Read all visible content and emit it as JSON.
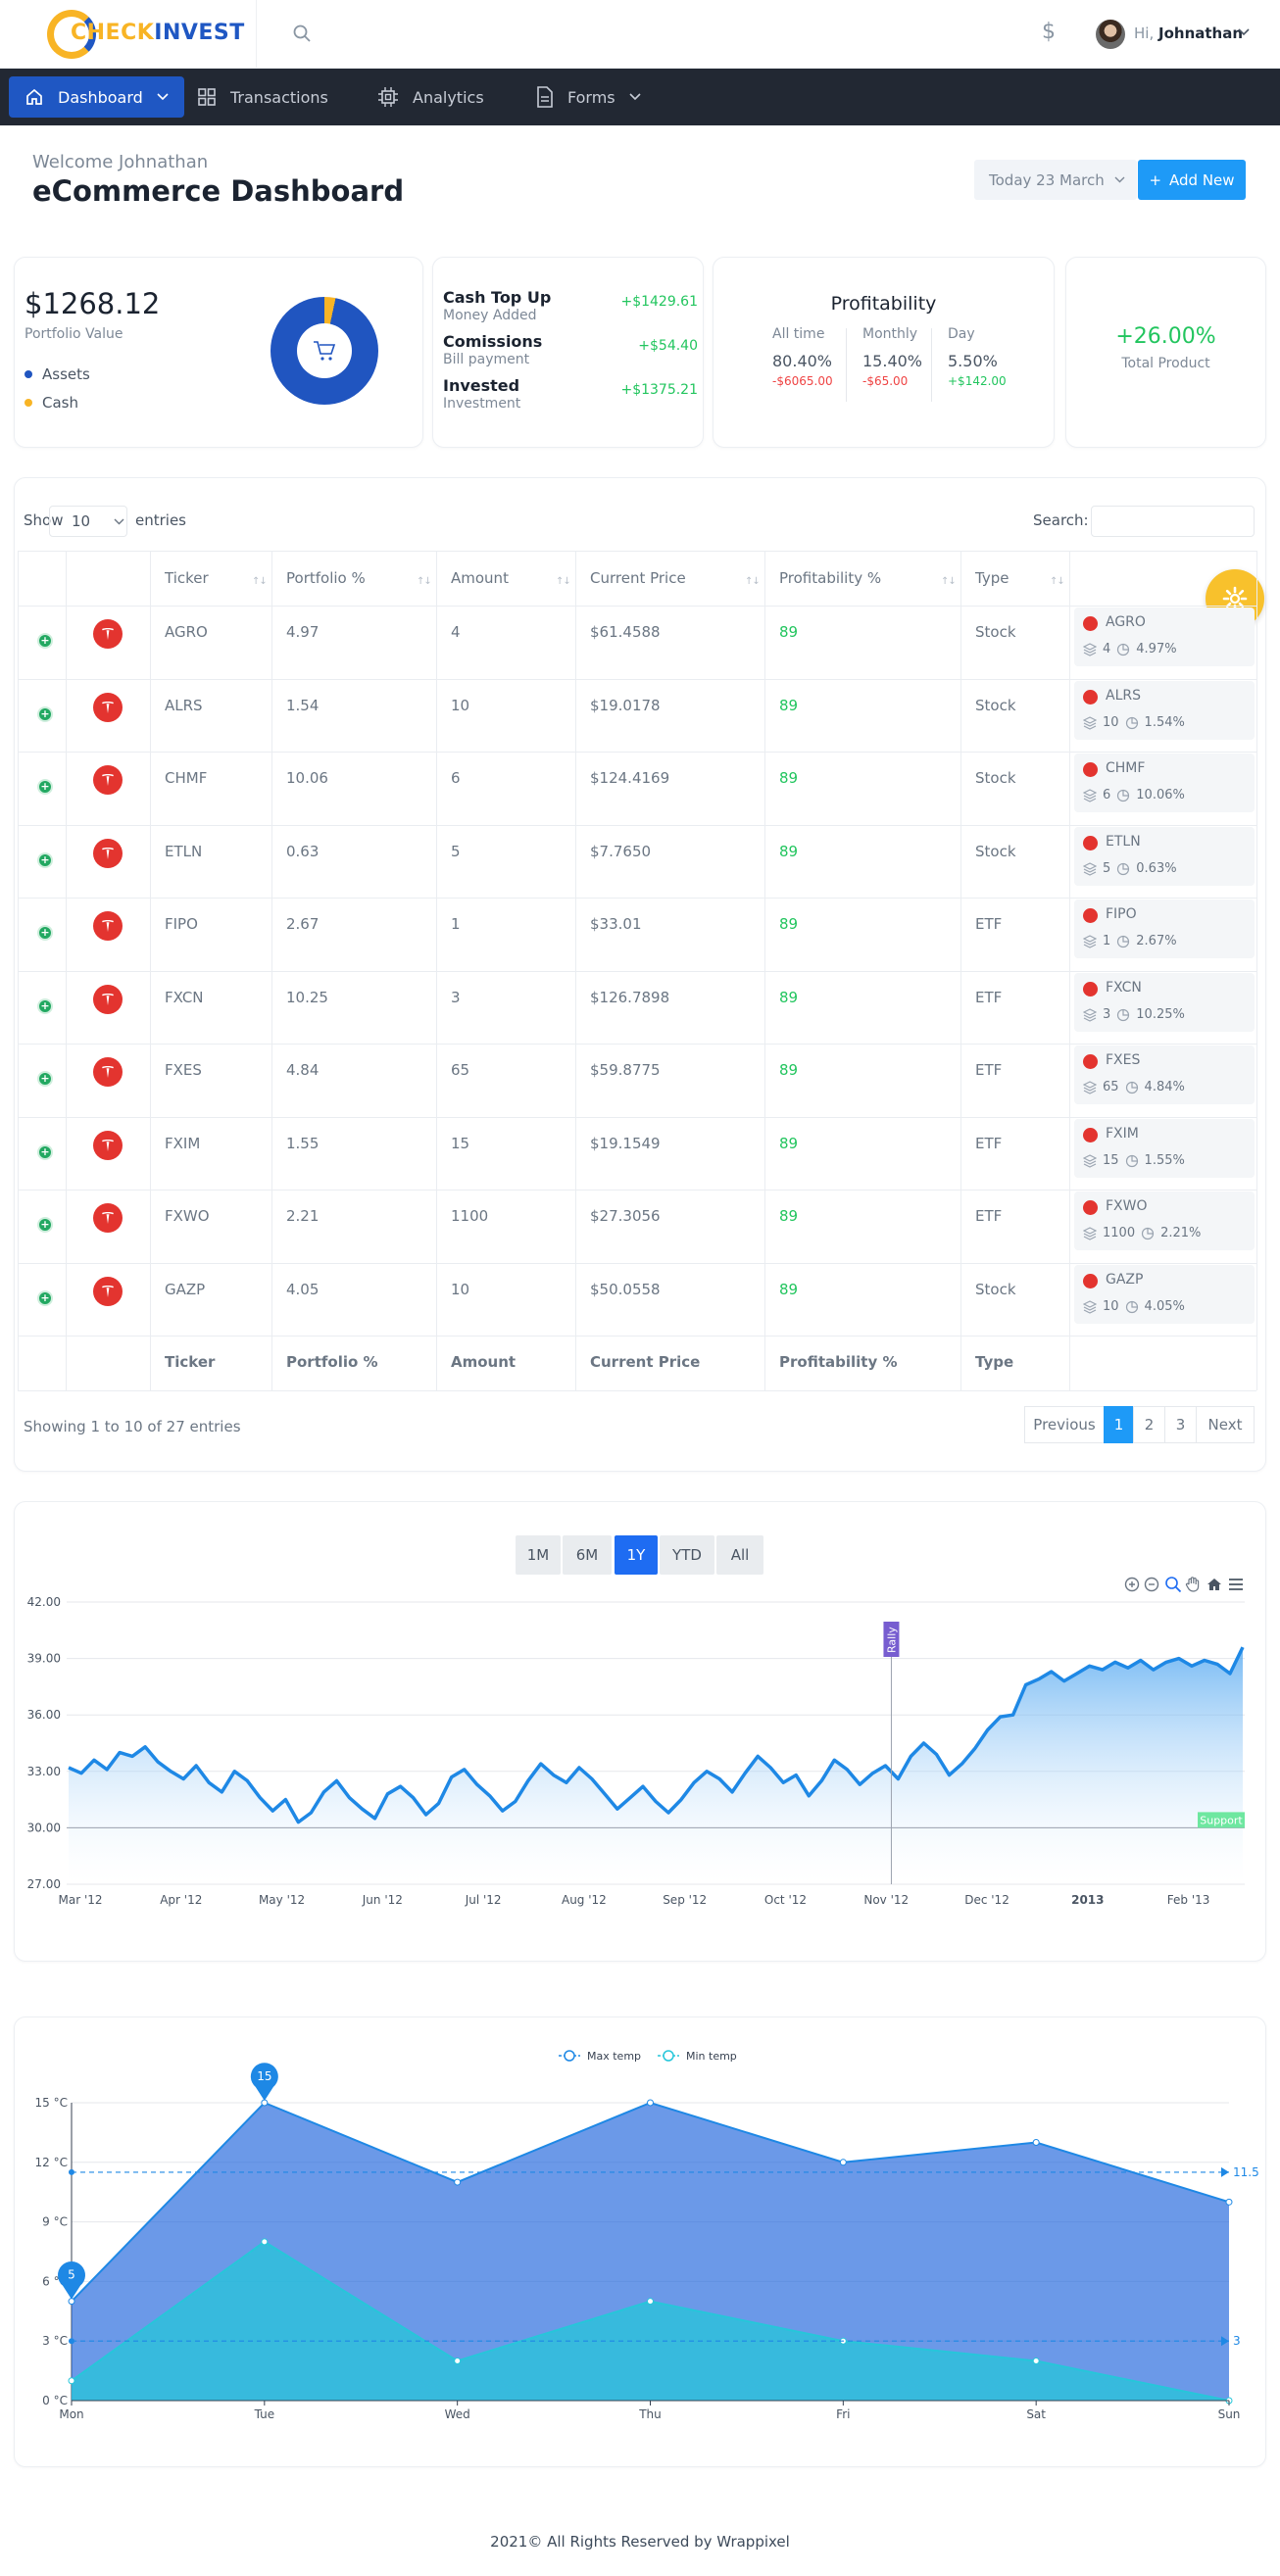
{
  "brand": {
    "part1": "CHECK",
    "part2": "INVEST"
  },
  "header": {
    "greeting": "Hi,",
    "user_name": "Johnathan"
  },
  "nav": [
    {
      "label": "Dashboard",
      "icon": "home-icon"
    },
    {
      "label": "Transactions",
      "icon": "grid-icon"
    },
    {
      "label": "Analytics",
      "icon": "cpu-icon"
    },
    {
      "label": "Forms",
      "icon": "file-icon"
    }
  ],
  "page": {
    "welcome": "Welcome Johnathan",
    "title": "eCommerce Dashboard",
    "date_label": "Today 23 March",
    "add_new_label": "Add New"
  },
  "portfolio": {
    "value": "$1268.12",
    "label": "Portfolio Value",
    "legend": [
      {
        "label": "Assets",
        "color": "#2055c0"
      },
      {
        "label": "Cash",
        "color": "#f8b425"
      }
    ]
  },
  "finance": [
    {
      "title": "Cash Top Up",
      "subtitle": "Money Added",
      "amount": "+$1429.61"
    },
    {
      "title": "Comissions",
      "subtitle": "Bill payment",
      "amount": "+$54.40"
    },
    {
      "title": "Invested",
      "subtitle": "Investment",
      "amount": "+$1375.21"
    }
  ],
  "profitability": {
    "title": "Profitability",
    "columns": [
      {
        "label": "All time",
        "value": "80.40%",
        "change": "-$6065.00",
        "positive": false
      },
      {
        "label": "Monthly",
        "value": "15.40%",
        "change": "-$65.00",
        "positive": false
      },
      {
        "label": "Day",
        "value": "5.50%",
        "change": "+$142.00",
        "positive": true
      }
    ]
  },
  "total_product": {
    "value": "+26.00%",
    "label": "Total Product"
  },
  "table": {
    "show_label": "Show",
    "entries_value": "10",
    "entries_label": "entries",
    "search_label": "Search:",
    "columns": [
      "Ticker",
      "Portfolio %",
      "Amount",
      "Current Price",
      "Profitability %",
      "Type"
    ],
    "rows": [
      {
        "ticker": "AGRO",
        "portfolio": "4.97",
        "amount": "4",
        "price": "$61.4588",
        "profit": "89",
        "type": "Stock",
        "side_amount": "4",
        "side_pct": "4.97%"
      },
      {
        "ticker": "ALRS",
        "portfolio": "1.54",
        "amount": "10",
        "price": "$19.0178",
        "profit": "89",
        "type": "Stock",
        "side_amount": "10",
        "side_pct": "1.54%"
      },
      {
        "ticker": "CHMF",
        "portfolio": "10.06",
        "amount": "6",
        "price": "$124.4169",
        "profit": "89",
        "type": "Stock",
        "side_amount": "6",
        "side_pct": "10.06%"
      },
      {
        "ticker": "ETLN",
        "portfolio": "0.63",
        "amount": "5",
        "price": "$7.7650",
        "profit": "89",
        "type": "Stock",
        "side_amount": "5",
        "side_pct": "0.63%"
      },
      {
        "ticker": "FIPO",
        "portfolio": "2.67",
        "amount": "1",
        "price": "$33.01",
        "profit": "89",
        "type": "ETF",
        "side_amount": "1",
        "side_pct": "2.67%"
      },
      {
        "ticker": "FXCN",
        "portfolio": "10.25",
        "amount": "3",
        "price": "$126.7898",
        "profit": "89",
        "type": "ETF",
        "side_amount": "3",
        "side_pct": "10.25%"
      },
      {
        "ticker": "FXES",
        "portfolio": "4.84",
        "amount": "65",
        "price": "$59.8775",
        "profit": "89",
        "type": "ETF",
        "side_amount": "65",
        "side_pct": "4.84%"
      },
      {
        "ticker": "FXIM",
        "portfolio": "1.55",
        "amount": "15",
        "price": "$19.1549",
        "profit": "89",
        "type": "ETF",
        "side_amount": "15",
        "side_pct": "1.55%"
      },
      {
        "ticker": "FXWO",
        "portfolio": "2.21",
        "amount": "1100",
        "price": "$27.3056",
        "profit": "89",
        "type": "ETF",
        "side_amount": "1100",
        "side_pct": "2.21%"
      },
      {
        "ticker": "GAZP",
        "portfolio": "4.05",
        "amount": "10",
        "price": "$50.0558",
        "profit": "89",
        "type": "Stock",
        "side_amount": "10",
        "side_pct": "4.05%"
      }
    ],
    "showing_text": "Showing 1 to 10 of 27 entries",
    "pagination": [
      "Previous",
      "1",
      "2",
      "3",
      "Next"
    ]
  },
  "chart_data": [
    {
      "type": "area",
      "range_buttons": [
        "1M",
        "6M",
        "1Y",
        "YTD",
        "All"
      ],
      "active_range": "1Y",
      "toolbar_icons": [
        "zoom-in-icon",
        "zoom-out-icon",
        "zoom-select-icon",
        "pan-hand-icon",
        "home-icon",
        "menu-icon"
      ],
      "y_ticks": [
        "27.00",
        "30.00",
        "33.00",
        "36.00",
        "39.00",
        "42.00"
      ],
      "ylim": [
        27,
        42
      ],
      "x_ticks": [
        "Mar '12",
        "Apr '12",
        "May '12",
        "Jun '12",
        "Jul '12",
        "Aug '12",
        "Sep '12",
        "Oct '12",
        "Nov '12",
        "Dec '12",
        "2013",
        "Feb '13"
      ],
      "series": [
        {
          "values": [
            33.2,
            32.9,
            33.6,
            33.1,
            34.0,
            33.8,
            34.3,
            33.5,
            33.0,
            32.6,
            33.3,
            32.4,
            31.9,
            33.0,
            32.5,
            31.6,
            30.9,
            31.5,
            30.3,
            30.8,
            31.9,
            32.5,
            31.6,
            31.0,
            30.5,
            31.8,
            32.2,
            31.6,
            30.7,
            31.3,
            32.7,
            33.1,
            32.3,
            31.7,
            30.9,
            31.4,
            32.5,
            33.4,
            32.8,
            32.4,
            33.2,
            32.6,
            31.8,
            31.0,
            31.6,
            32.2,
            31.4,
            30.8,
            31.5,
            32.4,
            33.0,
            32.6,
            31.9,
            32.9,
            33.8,
            33.2,
            32.4,
            32.8,
            31.7,
            32.5,
            33.6,
            33.1,
            32.3,
            32.9,
            33.3,
            32.6,
            33.8,
            34.5,
            33.9,
            32.8,
            33.4,
            34.2,
            35.2,
            35.9,
            36.0,
            37.6,
            37.9,
            38.3,
            37.8,
            38.2,
            38.6,
            38.4,
            38.8,
            38.5,
            38.9,
            38.4,
            38.8,
            39.0,
            38.6,
            38.9,
            38.7,
            38.2,
            39.6
          ]
        }
      ],
      "annotations": [
        {
          "label": "Rally",
          "x": "Nov '12"
        },
        {
          "label": "Support",
          "y": 30
        }
      ]
    },
    {
      "type": "area",
      "legend": [
        "Max temp",
        "Min temp"
      ],
      "categories": [
        "Mon",
        "Tue",
        "Wed",
        "Thu",
        "Fri",
        "Sat",
        "Sun"
      ],
      "y_ticks": [
        "0 °C",
        "3 °C",
        "6 °C",
        "9 °C",
        "12 °C",
        "15 °C"
      ],
      "ylim": [
        0,
        15
      ],
      "series": [
        {
          "name": "Max temp",
          "values": [
            5,
            15,
            11,
            15,
            12,
            13,
            10
          ],
          "color": "#1e88e5"
        },
        {
          "name": "Min temp",
          "values": [
            1,
            8,
            2,
            5,
            3,
            2,
            0
          ],
          "color": "#26c6da"
        }
      ],
      "markers": [
        "15",
        "5"
      ],
      "reference_lines": [
        "11.5",
        "3"
      ]
    }
  ],
  "footer": {
    "text": "2021© All Rights Reserved by Wrappixel"
  }
}
